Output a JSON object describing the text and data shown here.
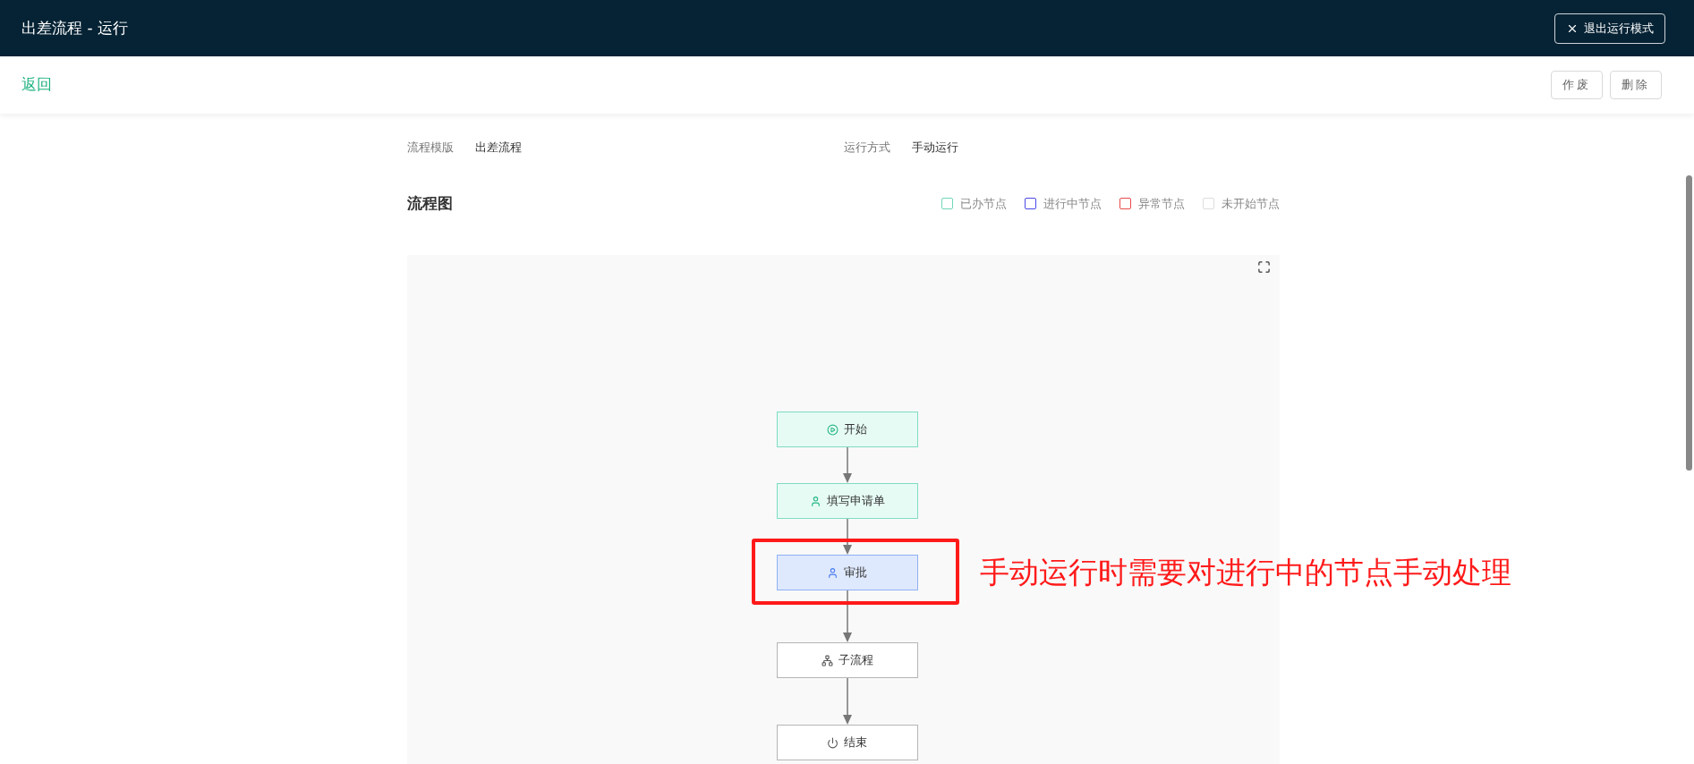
{
  "header": {
    "title": "出差流程 - 运行",
    "exit_button": "退出运行模式"
  },
  "toolbar": {
    "back_link": "返回",
    "buttons": [
      "作废",
      "删除"
    ]
  },
  "info": [
    {
      "label": "流程模版",
      "value": "出差流程"
    },
    {
      "label": "运行方式",
      "value": "手动运行"
    }
  ],
  "flow": {
    "title": "流程图",
    "legend": [
      {
        "label": "已办节点",
        "color": "#6fd8b8"
      },
      {
        "label": "进行中节点",
        "color": "#4a4ae8"
      },
      {
        "label": "异常节点",
        "color": "#e84a4a"
      },
      {
        "label": "未开始节点",
        "color": "#dddddd"
      }
    ],
    "nodes": [
      {
        "label": "开始",
        "kind": "start",
        "done": true,
        "in_progress": false
      },
      {
        "label": "填写申请单",
        "kind": "user",
        "done": true,
        "in_progress": false
      },
      {
        "label": "审批",
        "kind": "user",
        "done": false,
        "in_progress": true
      },
      {
        "label": "子流程",
        "kind": "subflow",
        "done": false,
        "in_progress": false
      },
      {
        "label": "结束",
        "kind": "end",
        "done": false,
        "in_progress": false
      }
    ],
    "annotation": "手动运行时需要对进行中的节点手动处理"
  }
}
